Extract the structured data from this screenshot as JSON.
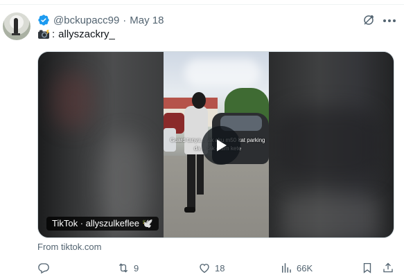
{
  "tweet": {
    "handle": "@bckupacc99",
    "separator": "·",
    "date": "May 18",
    "text_prefix": ":",
    "text_mention": "allyszackry_",
    "text_emoji_icon": "camera-with-flash-icon"
  },
  "media": {
    "tiktok_label": "TikTok · allyszulkeflee 🕊️",
    "caption": "Guard tanya… ak aku m50 kat parking da… tak claim kete"
  },
  "source": "From tiktok.com",
  "actions": {
    "reply_count": "",
    "retweet_count": "9",
    "like_count": "18",
    "views_count": "66K"
  },
  "colors": {
    "secondary_text": "#536471",
    "verified_blue": "#1d9bf0",
    "primary_text": "#0f1419"
  }
}
